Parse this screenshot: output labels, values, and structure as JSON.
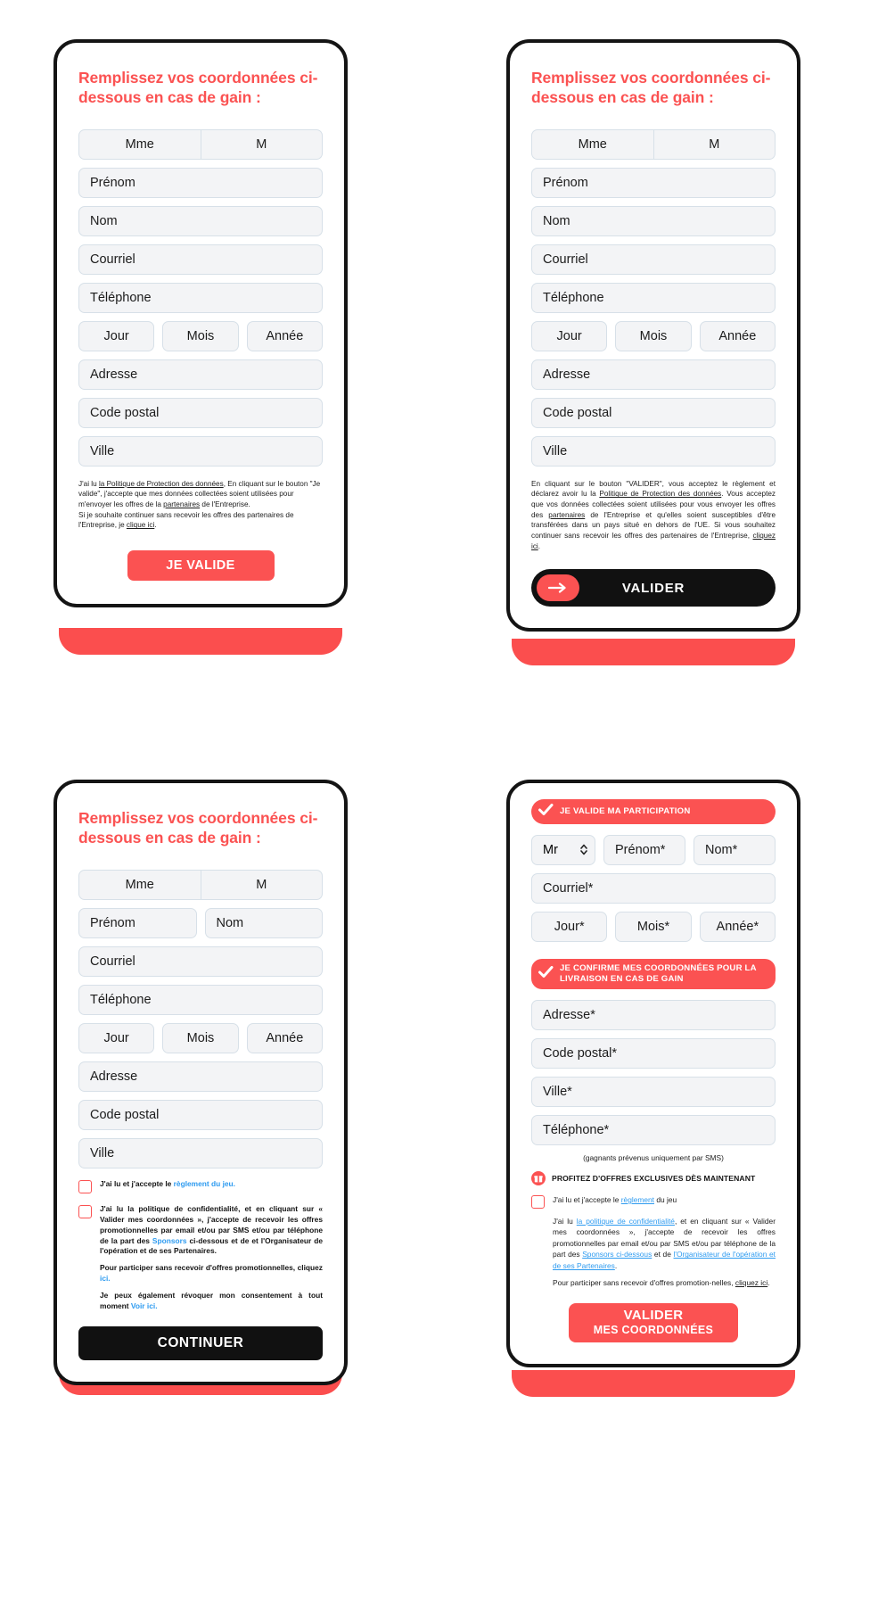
{
  "theme": {
    "accent": "#fb5252",
    "link_blue": "#2e9bf0",
    "dark": "#141414",
    "field_bg": "#f3f4f6",
    "field_border": "#d7e0e8"
  },
  "panel1": {
    "title": "Remplissez vos coordonnées ci-dessous en cas de gain :",
    "salutation": {
      "option_a": "Mme",
      "option_b": "M"
    },
    "fields": {
      "prenom": "Prénom",
      "nom": "Nom",
      "courriel": "Courriel",
      "telephone": "Téléphone",
      "jour": "Jour",
      "mois": "Mois",
      "annee": "Année",
      "adresse": "Adresse",
      "code_postal": "Code postal",
      "ville": "Ville"
    },
    "legal_line1_a": "J'ai lu ",
    "legal_line1_link": "la Politique de Protection des données",
    "legal_line1_b": ", En cliquant sur le bouton \"Je valide\", j'accepte que mes données collectées soient utilisées pour m'envoyer les offres de la ",
    "legal_line1_link2": "partenaires",
    "legal_line1_c": " de l'Entreprise.",
    "legal_line2_a": "Si je souhaite continuer sans recevoir les offres des partenaires de l'Entreprise, je ",
    "legal_line2_link": "clique ici",
    "legal_line2_b": ".",
    "submit_label": "JE VALIDE"
  },
  "panel2": {
    "title": "Remplissez vos coordonnées ci-dessous en cas de gain :",
    "salutation": {
      "option_a": "Mme",
      "option_b": "M"
    },
    "fields": {
      "prenom": "Prénom",
      "nom": "Nom",
      "courriel": "Courriel",
      "telephone": "Téléphone",
      "jour": "Jour",
      "mois": "Mois",
      "annee": "Année",
      "adresse": "Adresse",
      "code_postal": "Code postal",
      "ville": "Ville"
    },
    "legal_a": "En cliquant sur le bouton \"VALIDER\", vous acceptez le règlement et déclarez avoir lu la ",
    "legal_link1": "Politique de Protection des données",
    "legal_b": ". Vous acceptez que vos données collectées soient utilisées pour vous envoyer les offres des ",
    "legal_link2": "partenaires",
    "legal_c": " de l'Entreprise et qu'elles soient susceptibles d'être transférées dans un pays situé en dehors de l'UE. Si vous souhaitez continuer sans recevoir les offres des partenaires de l'Entreprise, ",
    "legal_link3": "cliquez ici",
    "legal_d": ".",
    "submit_label": "VALIDER",
    "arrow_icon": "arrow-right-icon"
  },
  "panel3": {
    "title": "Remplissez vos coordonnées ci-dessous en cas de gain :",
    "salutation": {
      "option_a": "Mme",
      "option_b": "M"
    },
    "fields": {
      "prenom": "Prénom",
      "nom": "Nom",
      "courriel": "Courriel",
      "telephone": "Téléphone",
      "jour": "Jour",
      "mois": "Mois",
      "annee": "Année",
      "adresse": "Adresse",
      "code_postal": "Code postal",
      "ville": "Ville"
    },
    "checkbox1_a": "J'ai lu et j'accepte le ",
    "checkbox1_link": "règlement du jeu.",
    "checkbox2_a": "J'ai lu la politique de confidentialité, et en cliquant sur « Valider mes coordonnées », j'accepte de recevoir les offres promotionnelles par email et/ou par SMS et/ou par téléphone de la part des ",
    "checkbox2_link1": "Sponsors",
    "checkbox2_b": " ci-dessous et de et l'Organisateur de l'opération et de ses Partenaires.",
    "checkbox2_c": "Pour participer sans recevoir d'offres promotionnelles, cliquez ",
    "checkbox2_link2": "ici.",
    "checkbox2_d": "Je peux également révoquer mon consentement à tout moment ",
    "checkbox2_link3": "Voir ici.",
    "submit_label": "CONTINUER"
  },
  "panel4": {
    "banner1": "JE VALIDE MA PARTICIPATION",
    "banner2": "JE CONFIRME MES COORDONNÉES POUR LA LIVRAISON EN CAS DE GAIN",
    "civilite": "Mr",
    "fields": {
      "prenom": "Prénom*",
      "nom": "Nom*",
      "courriel": "Courriel*",
      "jour": "Jour*",
      "mois": "Mois*",
      "annee": "Année*",
      "adresse": "Adresse*",
      "code_postal": "Code postal*",
      "ville": "Ville*",
      "telephone": "Téléphone*"
    },
    "note": "(gagnants prévenus uniquement par SMS)",
    "gift_banner": "PROFITEZ D'OFFRES EXCLUSIVES DÈS MAINTENANT",
    "gift_icon": "gift-icon",
    "checkbox1_a": "J'ai lu et j'accepte le ",
    "checkbox1_link": "règlement",
    "checkbox1_b": " du jeu",
    "legal_a": "J'ai lu ",
    "legal_link1": "la politique de confidentialité",
    "legal_b": ", et en cliquant sur « Valider mes coordonnées », j'accepte de recevoir les offres promotionnelles par email et/ou par SMS et/ou par téléphone de la part des ",
    "legal_link2": "Sponsors ci-dessous",
    "legal_c": " et de ",
    "legal_link3": "l'Organisateur de l'opération et de ses Partenaires",
    "legal_d": ".",
    "legal_e": "Pour participer sans recevoir d'offres promotion-nelles, ",
    "legal_link4": "cliquez ici",
    "legal_f": ".",
    "submit_label": "VALIDER",
    "submit_sub": "MES COORDONNÉES"
  }
}
